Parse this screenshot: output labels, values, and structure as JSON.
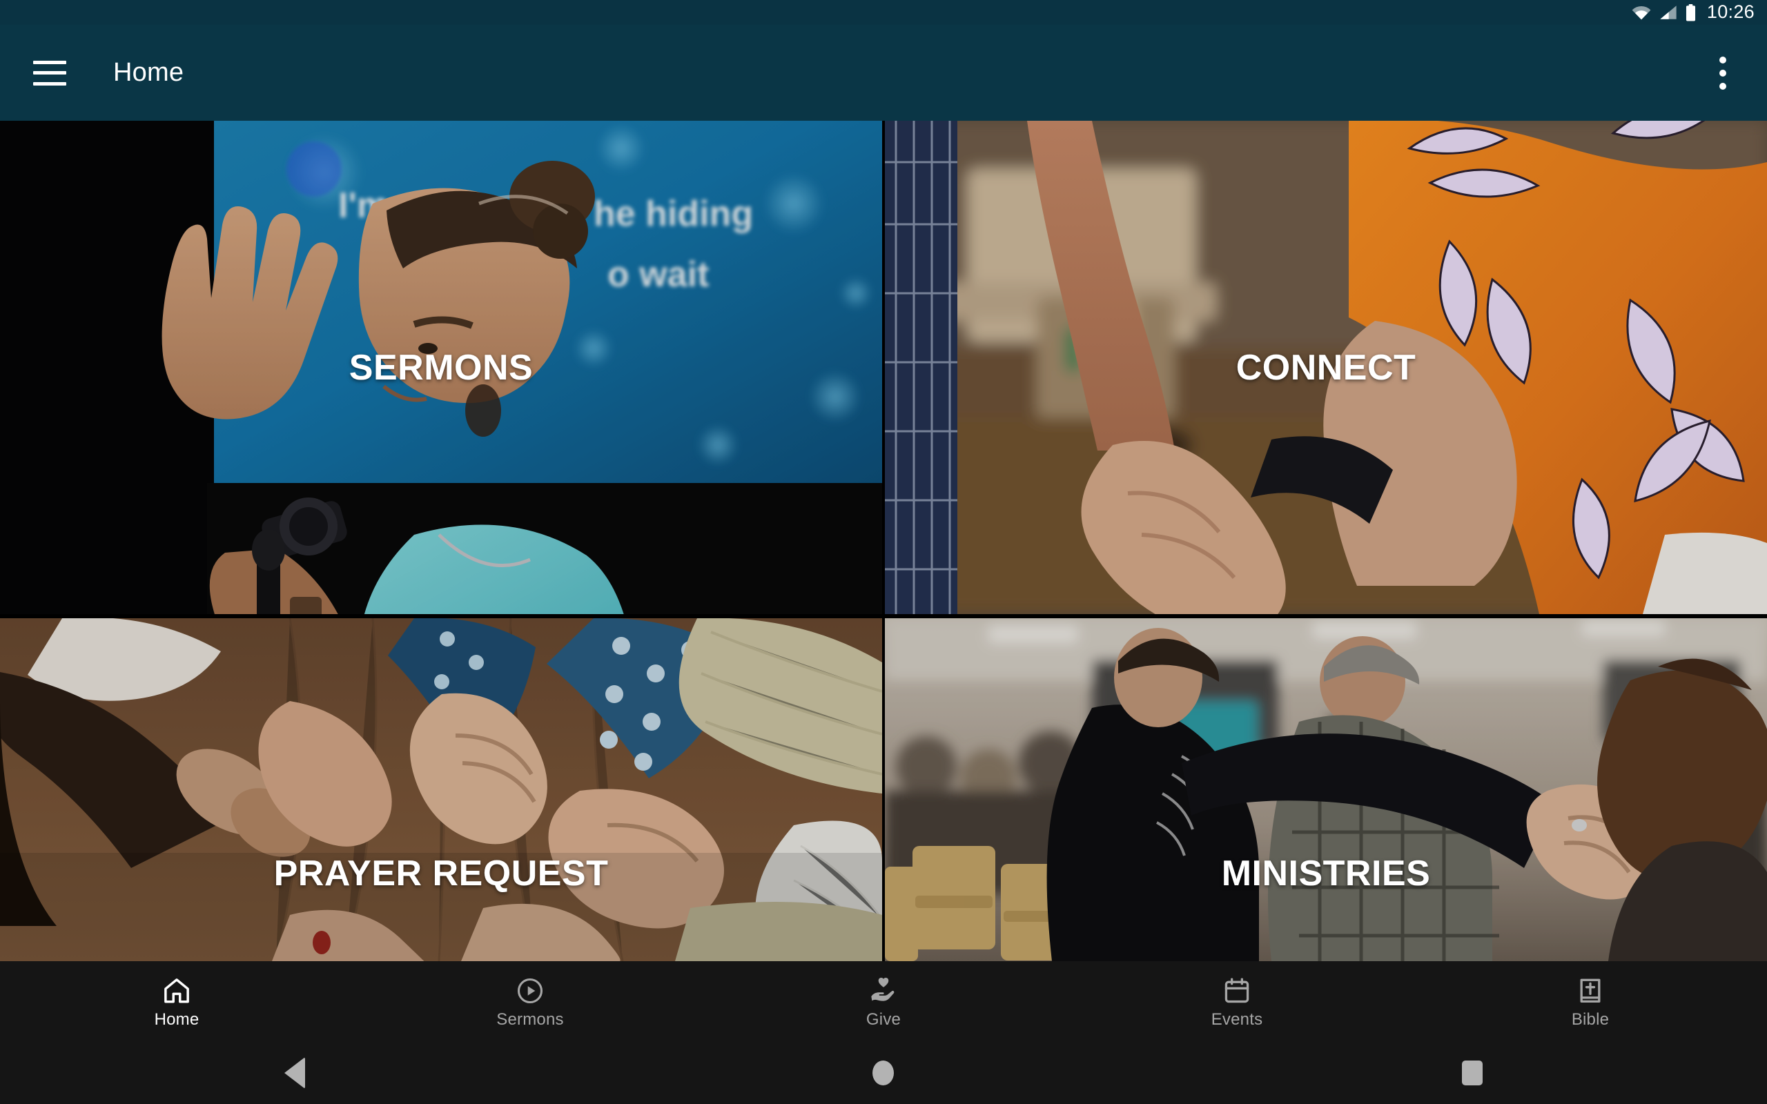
{
  "statusbar": {
    "time": "10:26",
    "icons": [
      "wifi-icon",
      "cellular-signal-icon",
      "battery-icon"
    ]
  },
  "appbar": {
    "menu_icon": "hamburger-menu-icon",
    "title": "Home",
    "overflow_icon": "more-vertical-icon",
    "background_color": "#0a3646"
  },
  "tiles": [
    {
      "id": "sermons",
      "label": "SERMONS",
      "image": "man-worshipping-with-raised-hand-on-stage"
    },
    {
      "id": "connect",
      "label": "CONNECT",
      "image": "two-people-holding-hands-outdoors"
    },
    {
      "id": "prayer-request",
      "label": "PRAYER REQUEST",
      "image": "circle-of-hands-joined-in-prayer-on-wooden-table"
    },
    {
      "id": "ministries",
      "label": "MINISTRIES",
      "image": "group-of-people-embracing-in-church-service"
    }
  ],
  "bottom_nav": {
    "items": [
      {
        "label": "Home",
        "icon": "church-home-icon",
        "active": true
      },
      {
        "label": "Sermons",
        "icon": "play-circle-icon",
        "active": false
      },
      {
        "label": "Give",
        "icon": "hand-heart-icon",
        "active": false
      },
      {
        "label": "Events",
        "icon": "calendar-icon",
        "active": false
      },
      {
        "label": "Bible",
        "icon": "book-cross-icon",
        "active": false
      }
    ],
    "active_color": "#ffffff",
    "inactive_color": "#a6a6a6",
    "background_color": "#151515"
  },
  "system_nav": {
    "buttons": [
      "back-button",
      "home-button",
      "recents-button"
    ]
  }
}
